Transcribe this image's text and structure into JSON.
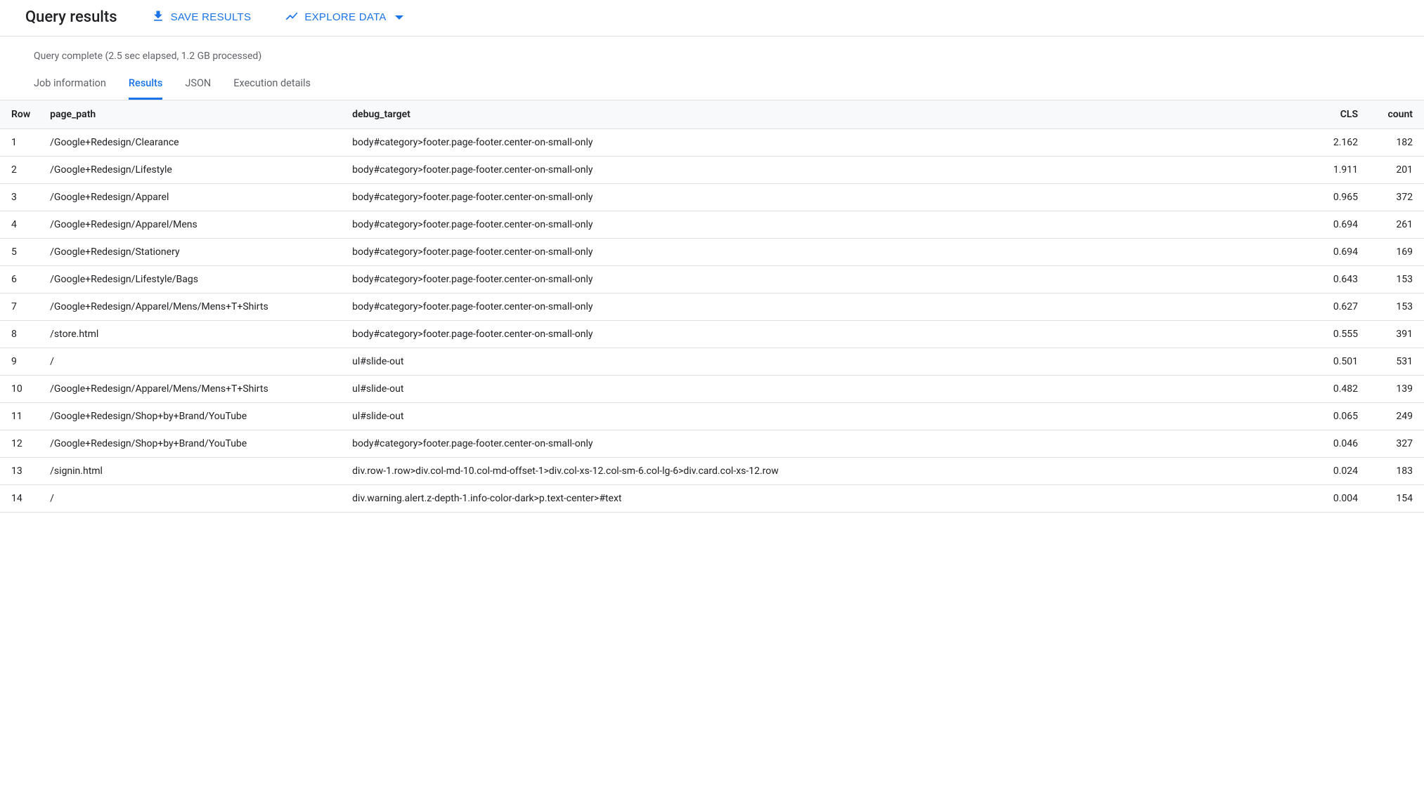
{
  "header": {
    "title": "Query results",
    "save_label": "SAVE RESULTS",
    "explore_label": "EXPLORE DATA"
  },
  "status": "Query complete (2.5 sec elapsed, 1.2 GB processed)",
  "tabs": [
    {
      "label": "Job information",
      "active": false
    },
    {
      "label": "Results",
      "active": true
    },
    {
      "label": "JSON",
      "active": false
    },
    {
      "label": "Execution details",
      "active": false
    }
  ],
  "table": {
    "columns": [
      "Row",
      "page_path",
      "debug_target",
      "CLS",
      "count"
    ],
    "rows": [
      {
        "row": "1",
        "page_path": "/Google+Redesign/Clearance",
        "debug_target": "body#category>footer.page-footer.center-on-small-only",
        "cls": "2.162",
        "count": "182"
      },
      {
        "row": "2",
        "page_path": "/Google+Redesign/Lifestyle",
        "debug_target": "body#category>footer.page-footer.center-on-small-only",
        "cls": "1.911",
        "count": "201"
      },
      {
        "row": "3",
        "page_path": "/Google+Redesign/Apparel",
        "debug_target": "body#category>footer.page-footer.center-on-small-only",
        "cls": "0.965",
        "count": "372"
      },
      {
        "row": "4",
        "page_path": "/Google+Redesign/Apparel/Mens",
        "debug_target": "body#category>footer.page-footer.center-on-small-only",
        "cls": "0.694",
        "count": "261"
      },
      {
        "row": "5",
        "page_path": "/Google+Redesign/Stationery",
        "debug_target": "body#category>footer.page-footer.center-on-small-only",
        "cls": "0.694",
        "count": "169"
      },
      {
        "row": "6",
        "page_path": "/Google+Redesign/Lifestyle/Bags",
        "debug_target": "body#category>footer.page-footer.center-on-small-only",
        "cls": "0.643",
        "count": "153"
      },
      {
        "row": "7",
        "page_path": "/Google+Redesign/Apparel/Mens/Mens+T+Shirts",
        "debug_target": "body#category>footer.page-footer.center-on-small-only",
        "cls": "0.627",
        "count": "153"
      },
      {
        "row": "8",
        "page_path": "/store.html",
        "debug_target": "body#category>footer.page-footer.center-on-small-only",
        "cls": "0.555",
        "count": "391"
      },
      {
        "row": "9",
        "page_path": "/",
        "debug_target": "ul#slide-out",
        "cls": "0.501",
        "count": "531"
      },
      {
        "row": "10",
        "page_path": "/Google+Redesign/Apparel/Mens/Mens+T+Shirts",
        "debug_target": "ul#slide-out",
        "cls": "0.482",
        "count": "139"
      },
      {
        "row": "11",
        "page_path": "/Google+Redesign/Shop+by+Brand/YouTube",
        "debug_target": "ul#slide-out",
        "cls": "0.065",
        "count": "249"
      },
      {
        "row": "12",
        "page_path": "/Google+Redesign/Shop+by+Brand/YouTube",
        "debug_target": "body#category>footer.page-footer.center-on-small-only",
        "cls": "0.046",
        "count": "327"
      },
      {
        "row": "13",
        "page_path": "/signin.html",
        "debug_target": "div.row-1.row>div.col-md-10.col-md-offset-1>div.col-xs-12.col-sm-6.col-lg-6>div.card.col-xs-12.row",
        "cls": "0.024",
        "count": "183"
      },
      {
        "row": "14",
        "page_path": "/",
        "debug_target": "div.warning.alert.z-depth-1.info-color-dark>p.text-center>#text",
        "cls": "0.004",
        "count": "154"
      }
    ]
  }
}
